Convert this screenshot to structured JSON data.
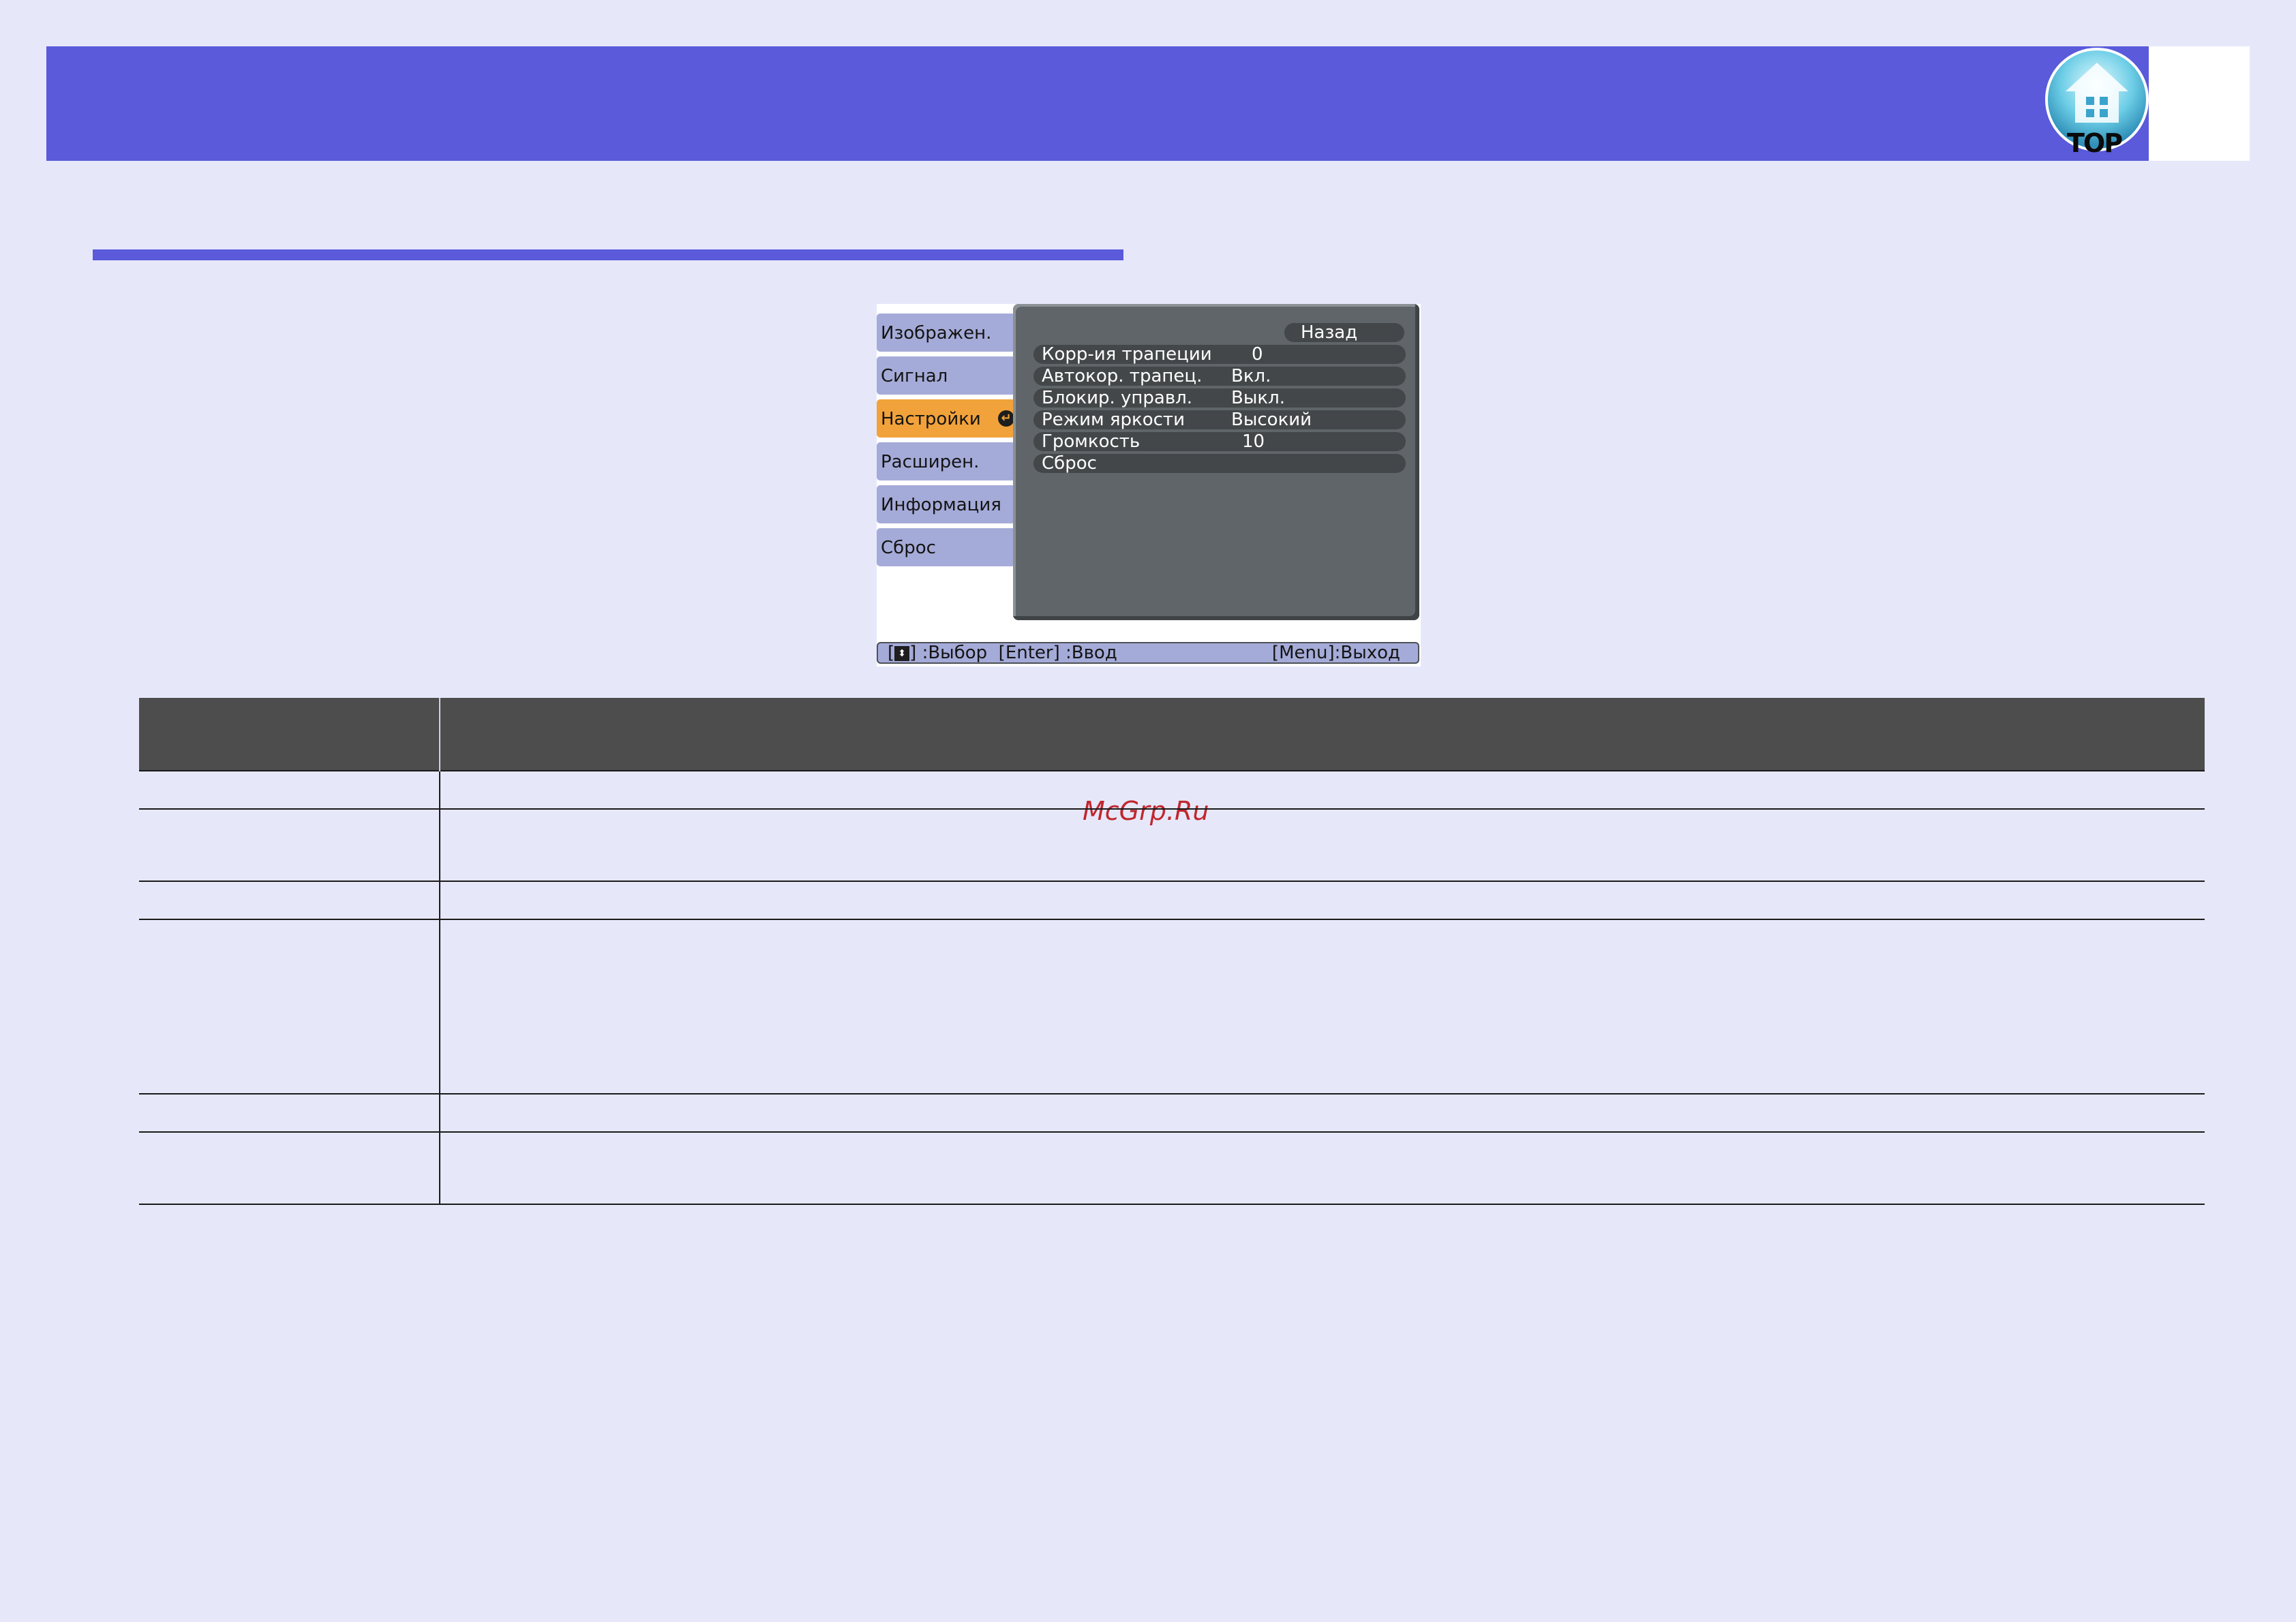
{
  "colors": {
    "header": "#5a5adb",
    "page_bg": "#e6e8fa",
    "menu_tab": "#a5abd8",
    "menu_tab_active": "#f2a23a",
    "menu_panel": "#5f6568",
    "table_header": "#4d4d4d",
    "watermark": "#c0272d"
  },
  "header": {
    "top_button_label": "TOP",
    "top_icon": "house-icon"
  },
  "menu": {
    "tabs": [
      {
        "label": "Изображен."
      },
      {
        "label": "Сигнал"
      },
      {
        "label": "Настройки",
        "active": true
      },
      {
        "label": "Расширен."
      },
      {
        "label": "Информация"
      },
      {
        "label": "Сброс"
      }
    ],
    "back_label": "Назад",
    "rows": [
      {
        "label": "Корр-ия трапеции",
        "value": "0"
      },
      {
        "label": "Автокор. трапец.",
        "value": "Вкл."
      },
      {
        "label": "Блокир. управл.",
        "value": "Выкл."
      },
      {
        "label": "Режим яркости",
        "value": "Высокий"
      },
      {
        "label": "Громкость",
        "value": "10"
      },
      {
        "label": "Сброс",
        "value": ""
      }
    ],
    "footer": {
      "select_bracket_open": "[",
      "select_text": "] :Выбор",
      "enter_text": "[Enter] :Ввод",
      "exit_text": "[Menu]:Выход"
    }
  },
  "watermark": "McGrp.Ru"
}
